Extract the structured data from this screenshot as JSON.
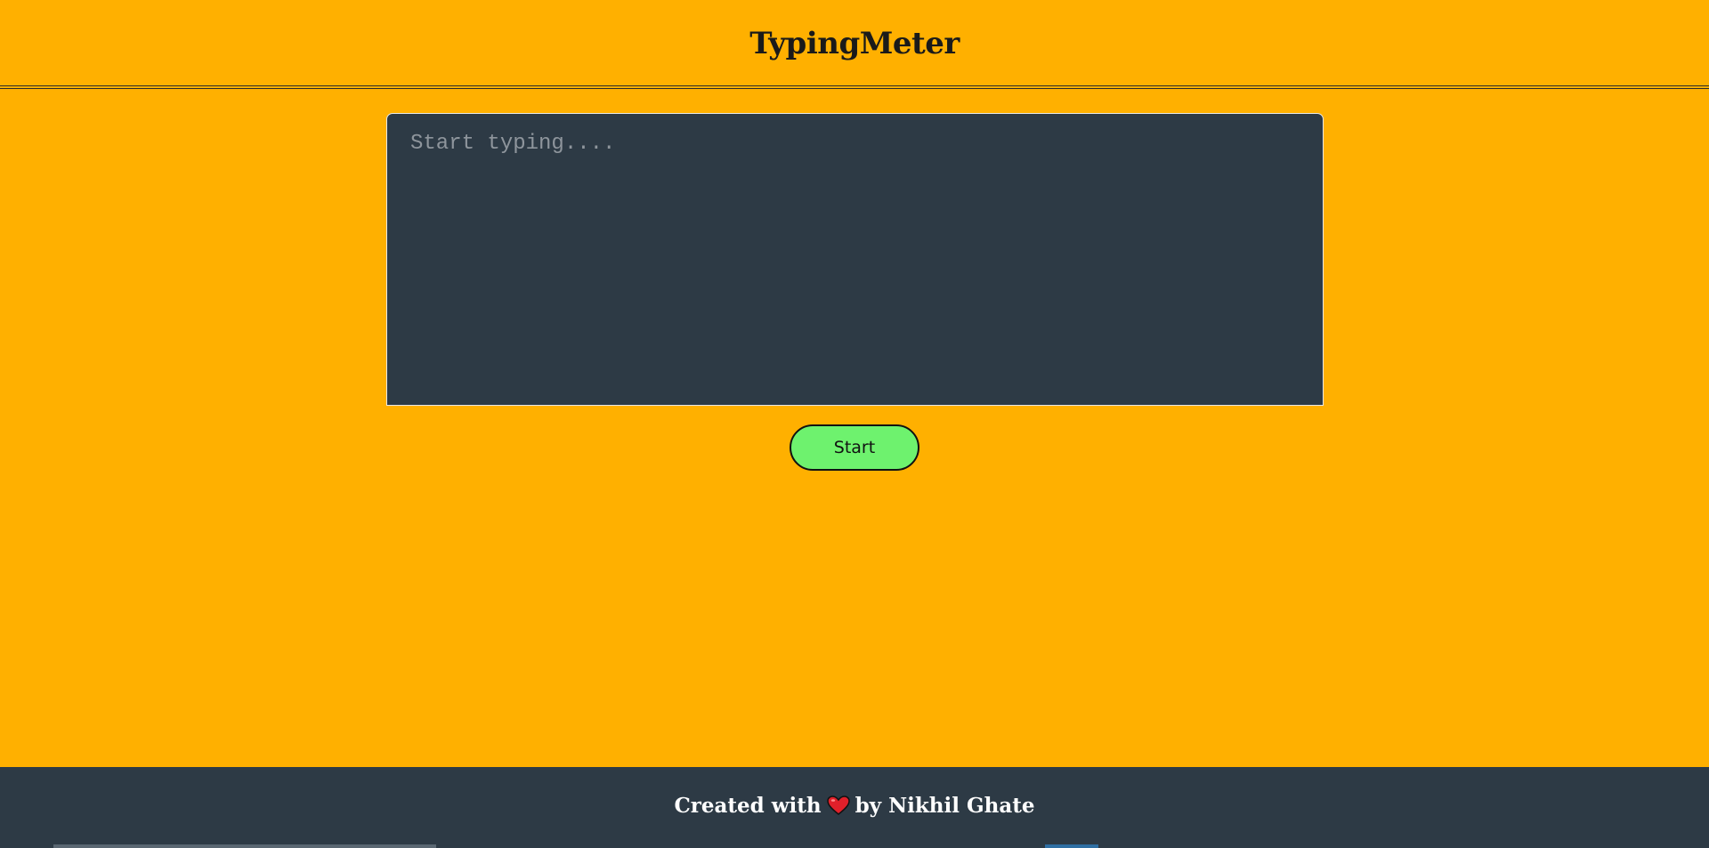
{
  "header": {
    "logo_text": "TypingMeter"
  },
  "main": {
    "typing_area": {
      "placeholder": "Start typing....",
      "value": ""
    },
    "start_button_label": "Start"
  },
  "footer": {
    "prefix": "Created with",
    "icon": "heart-icon",
    "suffix": "by Nikhil Ghate"
  },
  "colors": {
    "background": "#FFB000",
    "panel": "#2D3A45",
    "button": "#6EF26E",
    "heart": "#E0202A"
  }
}
